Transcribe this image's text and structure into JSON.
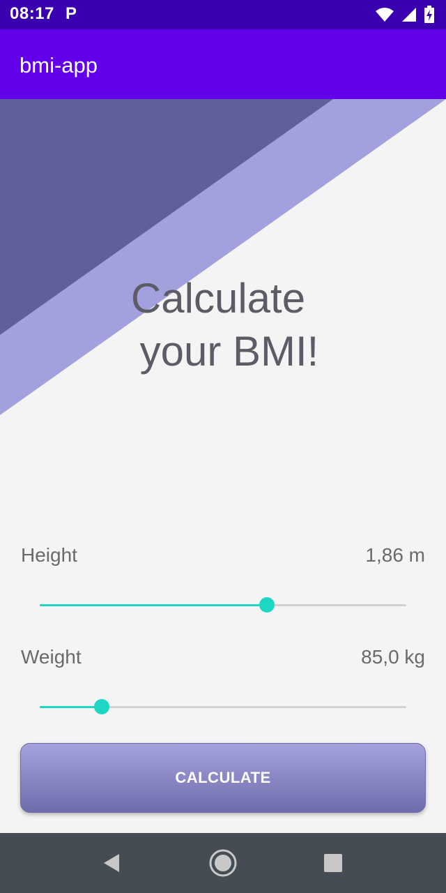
{
  "status_bar": {
    "time": "08:17",
    "notification_letter": "P",
    "icons": [
      "wifi-icon",
      "signal-icon",
      "battery-charging-icon"
    ]
  },
  "app_bar": {
    "title": "bmi-app",
    "color": "#6200ea"
  },
  "hero": {
    "title_line1": "Calculate",
    "title_line2": "your BMI!",
    "stripe_dark_color": "#5f5f9a",
    "stripe_light_color": "#a3a1dd"
  },
  "height": {
    "label": "Height",
    "value": "1,86 m",
    "slider_fraction": 0.62
  },
  "weight": {
    "label": "Weight",
    "value": "85,0 kg",
    "slider_fraction": 0.17
  },
  "accent_color": "#1ed6c4",
  "calculate_button": {
    "label": "CALCULATE"
  },
  "nav_bar": {
    "buttons": [
      "back-icon",
      "home-icon",
      "recents-icon"
    ]
  }
}
